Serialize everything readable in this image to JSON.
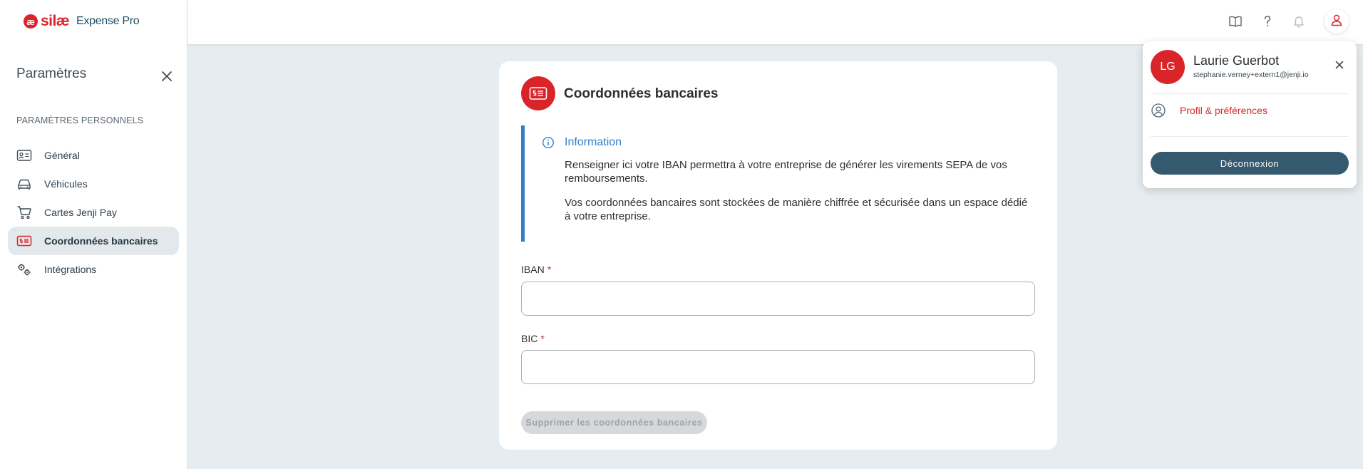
{
  "app": {
    "logo_mark": "æ",
    "brand": "silæ",
    "product": "Expense Pro"
  },
  "sidebar": {
    "title": "Paramètres",
    "section_label": "PARAMÈTRES PERSONNELS",
    "items": [
      {
        "label": "Général",
        "icon": "id-card-icon",
        "active": false
      },
      {
        "label": "Véhicules",
        "icon": "car-icon",
        "active": false
      },
      {
        "label": "Cartes Jenji Pay",
        "icon": "cart-icon",
        "active": false
      },
      {
        "label": "Coordonnées bancaires",
        "icon": "bank-card-icon",
        "active": true
      },
      {
        "label": "Intégrations",
        "icon": "gears-icon",
        "active": false
      }
    ]
  },
  "header": {
    "icons": [
      "book-icon",
      "help-icon",
      "bell-icon",
      "user-icon"
    ]
  },
  "card": {
    "title": "Coordonnées bancaires",
    "info": {
      "title": "Information",
      "p1": "Renseigner ici votre IBAN permettra à votre entreprise de générer les virements SEPA de vos remboursements.",
      "p2": "Vos coordonnées bancaires sont stockées de manière chiffrée et sécurisée dans un espace dédié à votre entreprise."
    },
    "iban_label": "IBAN",
    "iban_value": "",
    "bic_label": "BIC",
    "bic_value": "",
    "required_mark": "*",
    "delete_button": "Supprimer les coordonnées bancaires"
  },
  "profile_popup": {
    "initials": "LG",
    "name": "Laurie Guerbot",
    "email": "stephanie.verney+extern1@jenji.io",
    "link_label": "Profil & préférences",
    "logout_label": "Déconnexion"
  },
  "colors": {
    "accent": "#d9252a",
    "info_blue": "#3380cc",
    "logout": "#355a70",
    "background": "#e6ecef"
  }
}
